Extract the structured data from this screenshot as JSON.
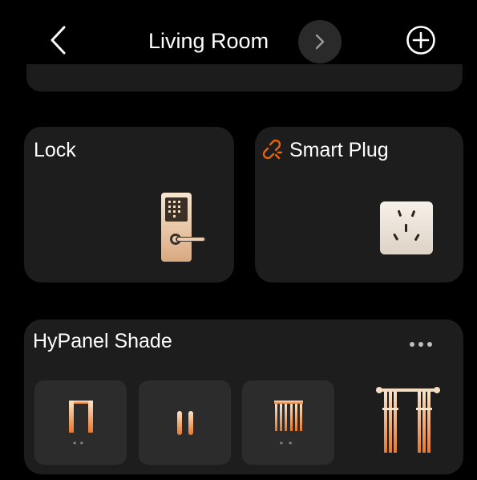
{
  "header": {
    "title": "Living Room",
    "back_icon": "chevron-left-icon",
    "next_icon": "chevron-right-icon",
    "add_icon": "plus-circle-icon"
  },
  "devices": {
    "lock": {
      "title": "Lock",
      "icon": "door-lock-icon"
    },
    "plug": {
      "title": "Smart Plug",
      "status_icon": "link-broken-icon",
      "icon": "power-outlet-icon",
      "status_color": "#e8640c"
    },
    "shade": {
      "title": "HyPanel Shade",
      "more_icon": "more-horizontal-icon",
      "controls": [
        {
          "name": "open",
          "icon": "curtain-open-icon"
        },
        {
          "name": "pause",
          "icon": "pause-icon"
        },
        {
          "name": "close",
          "icon": "curtain-close-icon"
        }
      ],
      "device_icon": "curtain-icon"
    }
  },
  "colors": {
    "background": "#000000",
    "card": "#1d1d1d",
    "button": "#2c2c2c",
    "accent_gradient_top": "#fbe3c8",
    "accent_gradient_bottom": "#e8782a"
  }
}
